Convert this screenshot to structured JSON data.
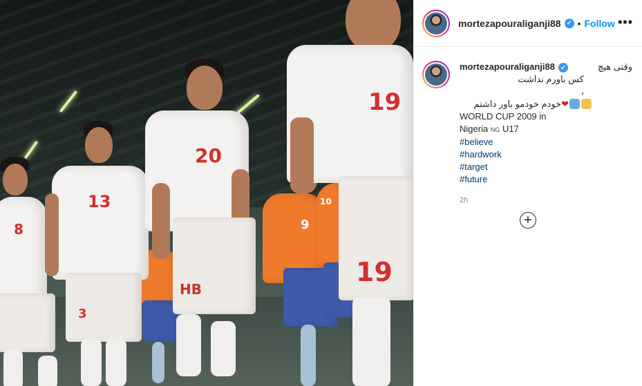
{
  "post": {
    "username": "mortezapouraliganji88",
    "follow_label": "Follow",
    "separator": "•",
    "more_label": "•••",
    "verified_mark": "✔"
  },
  "caption": {
    "username": "mortezapouraliganji88",
    "line1": "وقتی هیچ",
    "line2": "کس باورم نداشت",
    "line3": "،",
    "line4_text": "خودم خودمو باور داشتم",
    "heart": "❤",
    "line5": "WORLD CUP 2009 in",
    "line6_a": "Nigeria",
    "line6_flag": "NG",
    "line6_b": "U17",
    "hashtags": [
      "#believe",
      "#hardwork",
      "#target",
      "#future"
    ],
    "time": "2h"
  },
  "photo": {
    "numbers": [
      "8",
      "13",
      "20",
      "19",
      "19",
      "9",
      "10",
      "3",
      "HB"
    ]
  },
  "comments": {
    "load_more_symbol": "+"
  },
  "colors": {
    "link": "#0095f6",
    "hashtag": "#00376b",
    "verified": "#3897f0",
    "muted": "#8e8e8e"
  }
}
